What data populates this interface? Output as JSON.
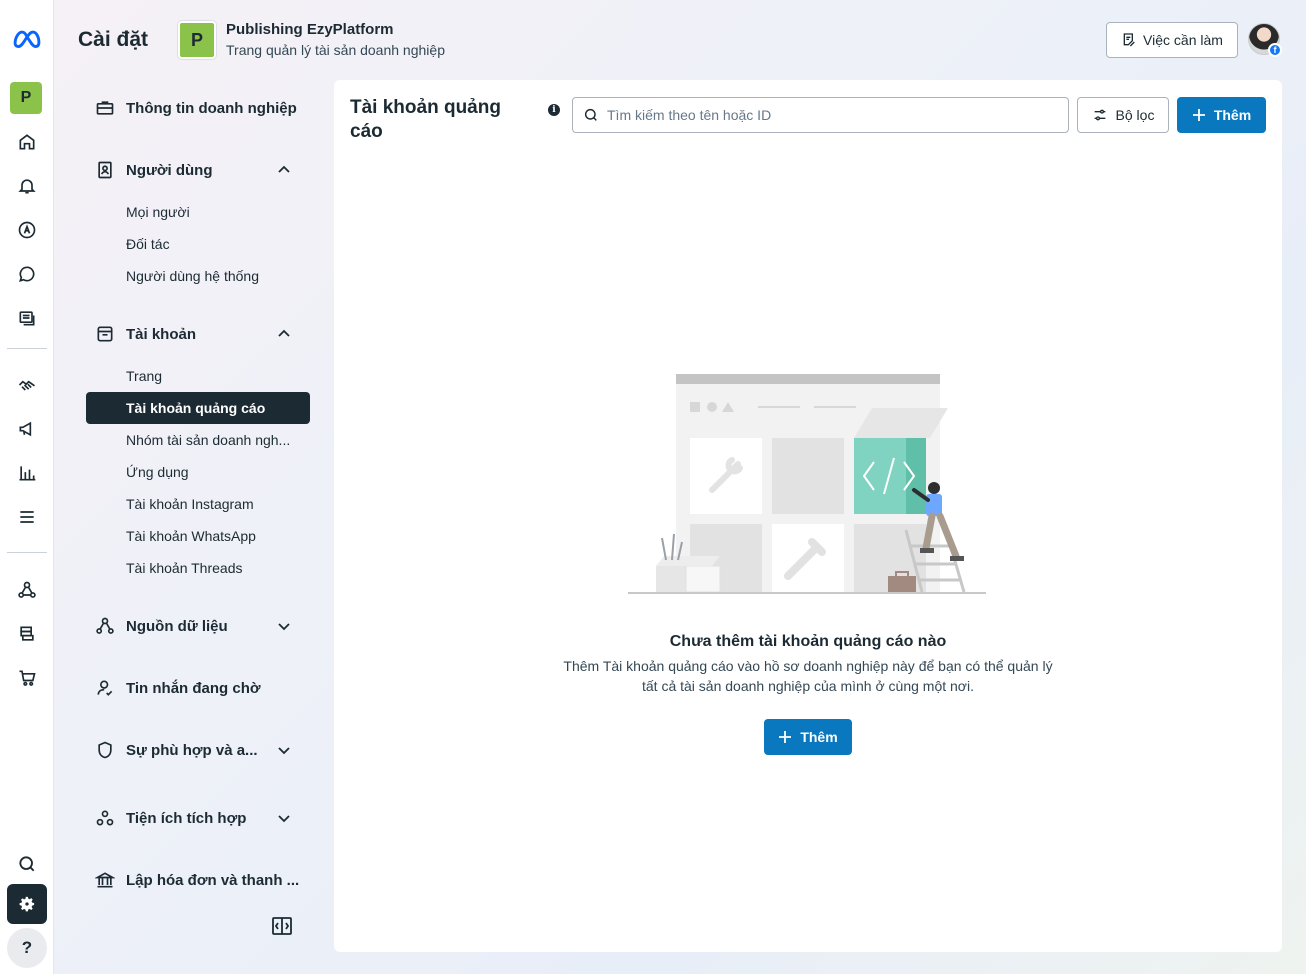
{
  "header": {
    "title": "Cài đặt",
    "business_initial": "P",
    "business_name": "Publishing EzyPlatform",
    "business_subtitle": "Trang quản lý tài sản doanh nghiệp",
    "todo_label": "Việc cần làm"
  },
  "rail": {
    "business_initial": "P",
    "help_label": "?"
  },
  "nav": {
    "business_info": "Thông tin doanh nghiệp",
    "users": {
      "label": "Người dùng",
      "items": [
        "Mọi người",
        "Đối tác",
        "Người dùng hệ thống"
      ]
    },
    "accounts": {
      "label": "Tài khoản",
      "items": [
        "Trang",
        "Tài khoản quảng cáo",
        "Nhóm tài sản doanh ngh...",
        "Ứng dụng",
        "Tài khoản Instagram",
        "Tài khoản WhatsApp",
        "Tài khoản Threads"
      ],
      "active_index": 1
    },
    "data_sources": "Nguồn dữ liệu",
    "pending_messages": "Tin nhắn đang chờ",
    "compliance": "Sự phù hợp và a...",
    "integrations": "Tiện ích tích hợp",
    "billing": "Lập hóa đơn và thanh ..."
  },
  "main": {
    "title": "Tài khoản quảng cáo",
    "info_icon": "i",
    "search_placeholder": "Tìm kiếm theo tên hoặc ID",
    "filter_label": "Bộ lọc",
    "add_label": "Thêm",
    "empty_title": "Chưa thêm tài khoản quảng cáo nào",
    "empty_desc": "Thêm Tài khoản quảng cáo vào hồ sơ doanh nghiệp này để bạn có thể quản lý tất cả tài sản doanh nghiệp của mình ở cùng một nơi.",
    "empty_add_label": "Thêm"
  },
  "colors": {
    "primary": "#0a78be",
    "dark": "#1c2b33",
    "badge": "#8bc34a",
    "illustration_teal": "#7fd3c0"
  }
}
